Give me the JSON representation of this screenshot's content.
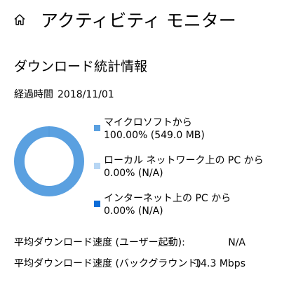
{
  "header": {
    "title": "アクティビティ モニター",
    "back_icon": "home-icon"
  },
  "section": {
    "title": "ダウンロード統計情報"
  },
  "elapsed": {
    "label": "経過時間",
    "value": "2018/11/01"
  },
  "colors": {
    "microsoft": "#5aa0e0",
    "local_pc": "#b7d6f4",
    "internet_pc": "#0c6cd8"
  },
  "legend": [
    {
      "label": "マイクロソフトから",
      "value": "100.00%  (549.0 MB)",
      "color": "#5aa0e0",
      "fraction": 1.0
    },
    {
      "label": "ローカル ネットワーク上の PC から",
      "value": "0.00%  (N/A)",
      "color": "#b7d6f4",
      "fraction": 0.0
    },
    {
      "label": "インターネット上の PC から",
      "value": "0.00%  (N/A)",
      "color": "#0c6cd8",
      "fraction": 0.0
    }
  ],
  "stats": [
    {
      "label": "平均ダウンロード速度 (ユーザー起動):",
      "value": "N/A"
    },
    {
      "label": "平均ダウンロード速度 (バックグラウンド)",
      "value": "14.3 Mbps"
    }
  ]
}
